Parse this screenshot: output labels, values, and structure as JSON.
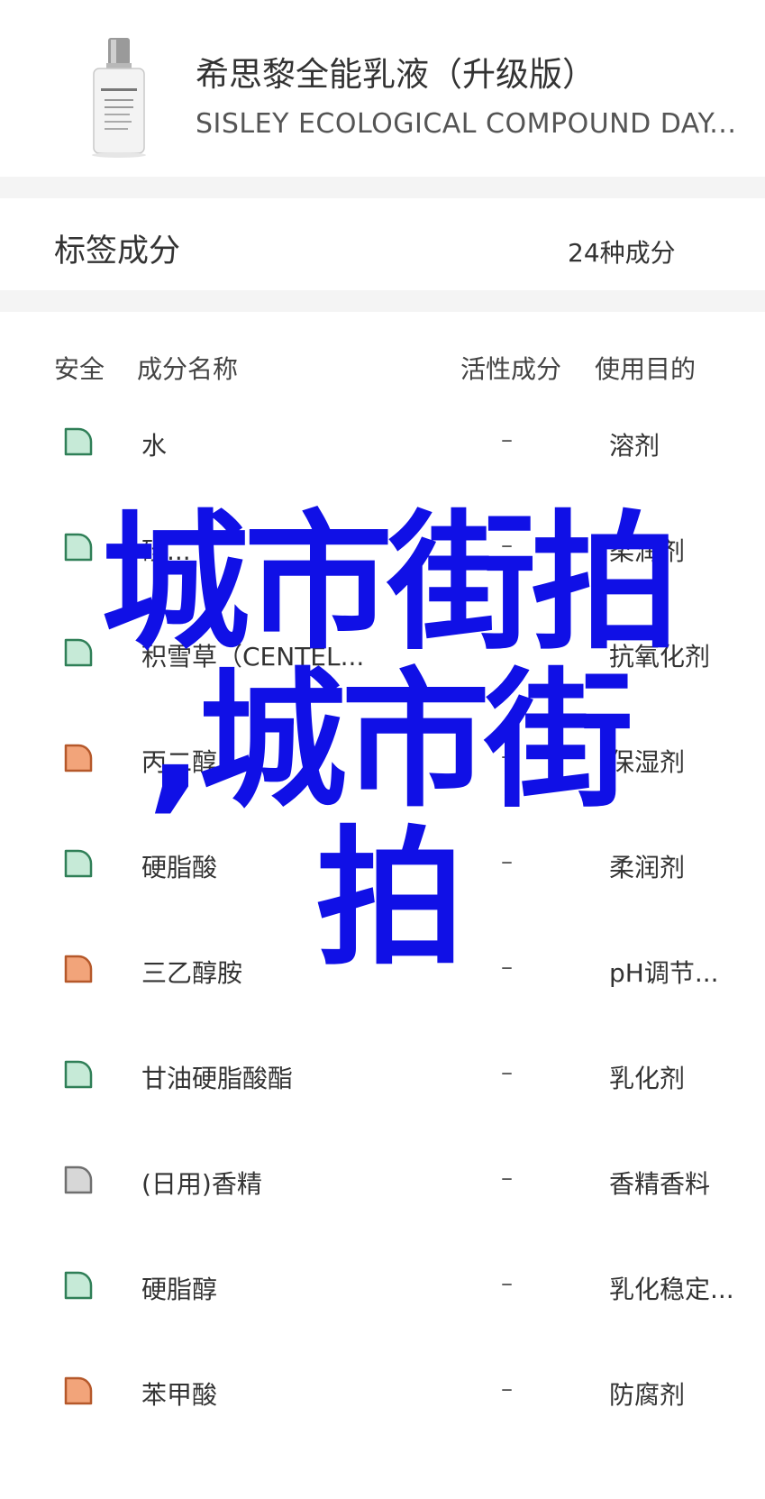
{
  "product": {
    "name_cn": "希思黎全能乳液（升级版）",
    "name_en": "SISLEY ECOLOGICAL COMPOUND DAY..."
  },
  "summary": {
    "label": "标签成分",
    "value": "24种成分"
  },
  "table": {
    "headers": {
      "safety": "安全",
      "name": "成分名称",
      "active": "活性成分",
      "purpose": "使用目的"
    },
    "rows": [
      {
        "safety": "green",
        "name": "水",
        "active": "–",
        "purpose": "溶剂"
      },
      {
        "safety": "green",
        "name": "硅...",
        "active": "–",
        "purpose": "柔润剂"
      },
      {
        "safety": "green",
        "name": "积雪草（CENTEL...",
        "active": "",
        "purpose": "抗氧化剂"
      },
      {
        "safety": "orange",
        "name": "丙二醇",
        "active": "–",
        "purpose": "保湿剂"
      },
      {
        "safety": "green",
        "name": "硬脂酸",
        "active": "–",
        "purpose": "柔润剂"
      },
      {
        "safety": "orange",
        "name": "三乙醇胺",
        "active": "–",
        "purpose": "pH调节..."
      },
      {
        "safety": "green",
        "name": "甘油硬脂酸酯",
        "active": "–",
        "purpose": "乳化剂"
      },
      {
        "safety": "gray",
        "name": "(日用)香精",
        "active": "–",
        "purpose": "香精香料"
      },
      {
        "safety": "green",
        "name": "硬脂醇",
        "active": "–",
        "purpose": "乳化稳定..."
      },
      {
        "safety": "orange",
        "name": "苯甲酸",
        "active": "–",
        "purpose": "防腐剂"
      }
    ]
  },
  "overlay": {
    "line1": "城市街拍",
    "line2": ",城市街",
    "line3": "拍"
  },
  "colors": {
    "green_fill": "#c6ead7",
    "green_stroke": "#2f7f57",
    "orange_fill": "#f2a47a",
    "orange_stroke": "#b5582a",
    "gray_fill": "#d7d7d7",
    "gray_stroke": "#6f6f6f",
    "overlay": "#1010e6"
  }
}
